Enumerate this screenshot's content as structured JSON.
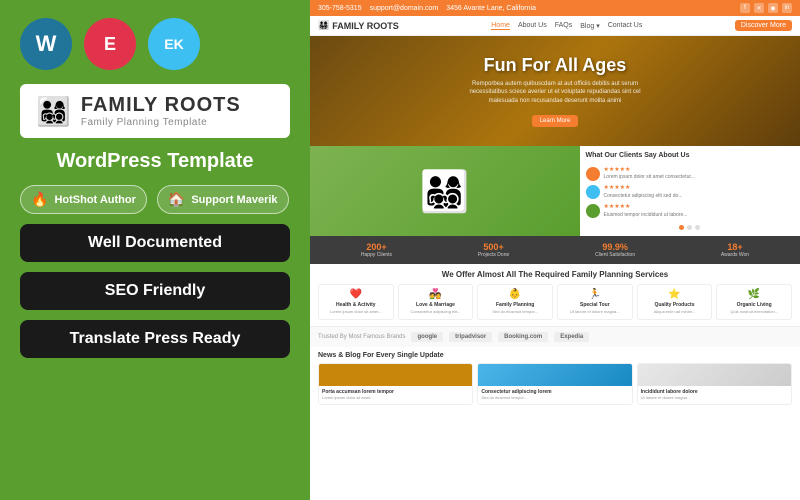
{
  "left": {
    "icons": {
      "wp_label": "W",
      "el_label": "E",
      "ek_label": "EK"
    },
    "logo": {
      "icon": "👨‍👩‍👧‍👦",
      "title": "FAMILY ROOTS",
      "subtitle": "Family Planning Template"
    },
    "template_label": "WordPress Template",
    "badges": [
      {
        "id": "hotshot",
        "icon": "🔥",
        "text": "HotShot Author"
      },
      {
        "id": "support",
        "icon": "🏠",
        "text": "Support Maverik"
      }
    ],
    "features": [
      {
        "id": "well-documented",
        "label": "Well Documented"
      },
      {
        "id": "seo-friendly",
        "label": "SEO Friendly"
      },
      {
        "id": "translate-press",
        "label": "Translate Press Ready"
      }
    ]
  },
  "site": {
    "topbar": {
      "phone": "305-758-5315",
      "email": "support@domain.com",
      "address": "3456 Avante Lane, California"
    },
    "nav": {
      "logo": "FAMILY ROOTS",
      "links": [
        "Home",
        "About Us",
        "FAQs",
        "Blog",
        "Contact Us"
      ],
      "cta": "Discover More"
    },
    "hero": {
      "title": "Fun For All Ages",
      "desc": "Remporbea autem quibuscdam at aut officiis debitis aut serum necessitatibus sciece averier ut et voluptate repudiandas sint cel malesuada non recusandae deserunt molita animi",
      "btn": "Learn More"
    },
    "testimonials": {
      "title": "What Our Clients Say About Us",
      "items": [
        {
          "stars": "★★★★★",
          "text": "Lorem ipsum dolor sit amet consectetur..."
        },
        {
          "stars": "★★★★★",
          "text": "Consectetur adipiscing elit sed do..."
        },
        {
          "stars": "★★★★★",
          "text": "Eiusmod tempor incididunt ut labore..."
        }
      ]
    },
    "brands": {
      "label": "Trusted By Most Famous Brands",
      "logos": [
        "google",
        "tripadvisor",
        "Booking.com",
        "Expedia"
      ]
    },
    "stats": [
      {
        "num": "200+",
        "label": "Happy Clients"
      },
      {
        "num": "500+",
        "label": "Projects Done"
      },
      {
        "num": "99.9%",
        "label": "Client Satisfaction"
      },
      {
        "num": "18+",
        "label": "Awards Won"
      }
    ],
    "services": {
      "title": "We Offer Almost All The Required Family Planning Services",
      "items": [
        {
          "icon": "❤️",
          "name": "Health & Activity",
          "desc": "Lorem ipsum dolor sit amet..."
        },
        {
          "icon": "💑",
          "name": "Love & Marriage",
          "desc": "Consectetur adipiscing elit..."
        },
        {
          "icon": "👶",
          "name": "Family Planning",
          "desc": "Sed do eiusmod tempor..."
        },
        {
          "icon": "🏃",
          "name": "Special Tour",
          "desc": "Ut labore et dolore magna..."
        },
        {
          "icon": "⭐",
          "name": "Quality Products",
          "desc": "Aliqua enim ad minim..."
        },
        {
          "icon": "🌿",
          "name": "Organic Living",
          "desc": "Quis nostrud exercitation..."
        }
      ]
    },
    "blog": {
      "title": "News & Blog For Every Single Update",
      "items": [
        {
          "img_class": "img1",
          "title": "Porta accumsan lorem tempor",
          "desc": "Lorem ipsum dolor sit amet..."
        },
        {
          "img_class": "img2",
          "title": "Consectetur adipiscing lorem",
          "desc": "Sed do eiusmod tempor..."
        },
        {
          "img_class": "img3",
          "title": "Incididunt labore dolore",
          "desc": "Ut labore et dolore magna..."
        }
      ]
    }
  }
}
